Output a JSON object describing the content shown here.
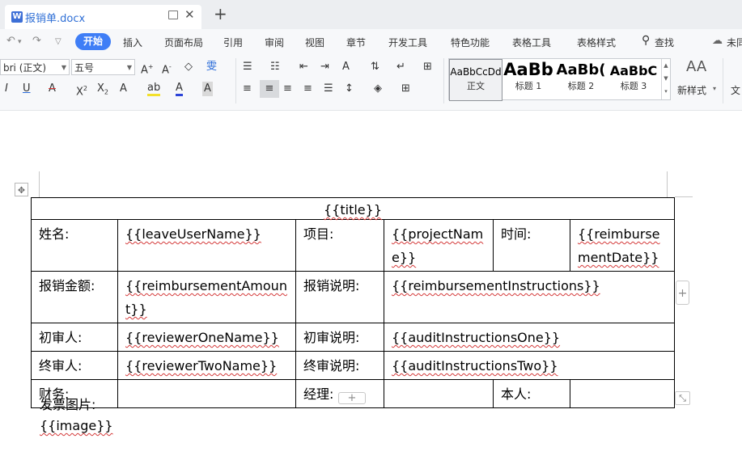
{
  "titlebar": {
    "tab_title": "报销单.docx",
    "app_icon": "W",
    "new_tab": "+"
  },
  "menubar": {
    "undo_icon": "undo-icon",
    "redo_icon": "redo-icon",
    "items": [
      "开始",
      "插入",
      "页面布局",
      "引用",
      "审阅",
      "视图",
      "章节",
      "开发工具",
      "特色功能",
      "表格工具",
      "表格样式",
      "查找",
      "未同"
    ],
    "active": "开始"
  },
  "ribbon": {
    "font_name": "bri (正文)",
    "font_size": "五号",
    "styles": [
      {
        "sample": "AaBbCcDd",
        "label": "正文"
      },
      {
        "sample": "AaBb",
        "label": "标题 1"
      },
      {
        "sample": "AaBb(",
        "label": "标题 2"
      },
      {
        "sample": "AaBbC",
        "label": "标题 3"
      }
    ],
    "new_style": "新样式",
    "text_more": "文"
  },
  "document": {
    "title": "{{title}}",
    "rows": [
      {
        "label1": "姓名:",
        "value1": "{{leaveUserName}}",
        "label2": "项目:",
        "value2": "{{projectName}}",
        "label3": "时间:",
        "value3": "{{reimbursementDate}}"
      },
      {
        "label1": "报销金额:",
        "value1": "{{reimbursementAmount}}",
        "label2": "报销说明:",
        "value2": "{{reimbursementInstructions}}"
      },
      {
        "label1": "初审人:",
        "value1": "{{reviewerOneName}}",
        "label2": "初审说明:",
        "value2": "{{auditInstructionsOne}}"
      },
      {
        "label1": "终审人:",
        "value1": "{{reviewerTwoName}}",
        "label2": "终审说明:",
        "value2": "{{auditInstructionsTwo}}"
      },
      {
        "label1": "财务:",
        "value1": "",
        "label2": "经理:",
        "value2": "",
        "label3": "本人:",
        "value3": ""
      }
    ],
    "invoice_label": "发票图片:",
    "image_placeholder": "{{image}}"
  }
}
